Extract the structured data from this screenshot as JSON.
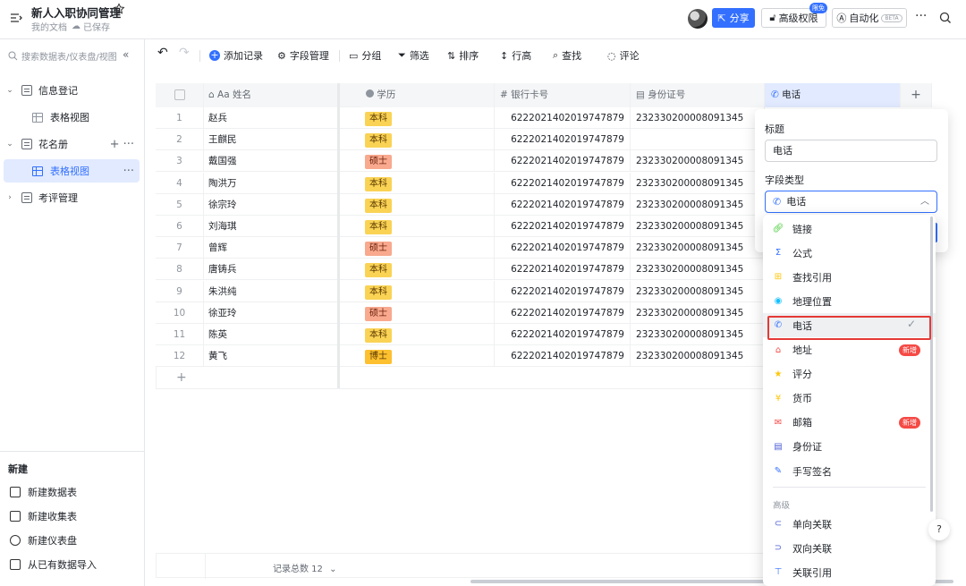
{
  "header": {
    "title": "新人入职协同管理",
    "subtitle": "我的文档",
    "saved": "已保存",
    "share_label": "分享",
    "permission_label": "高级权限",
    "limited_badge": "限免",
    "automation_label": "自动化",
    "beta_label": "BETA"
  },
  "sidebar": {
    "search_placeholder": "搜索数据表/仪表盘/视图",
    "items": [
      {
        "label": "信息登记"
      },
      {
        "label": "表格视图"
      },
      {
        "label": "花名册"
      },
      {
        "label": "表格视图"
      },
      {
        "label": "考评管理"
      }
    ],
    "new_header": "新建",
    "new_items": [
      {
        "label": "新建数据表"
      },
      {
        "label": "新建收集表"
      },
      {
        "label": "新建仪表盘"
      },
      {
        "label": "从已有数据导入"
      }
    ]
  },
  "toolbar": {
    "add_record": "添加记录",
    "field_manage": "字段管理",
    "group": "分组",
    "filter": "筛选",
    "sort": "排序",
    "row_height": "行高",
    "find": "查找",
    "comment": "评论"
  },
  "table": {
    "headers": {
      "name": "姓名",
      "edu": "学历",
      "bank": "银行卡号",
      "id": "身份证号",
      "phone": "电话"
    },
    "rows": [
      {
        "num": "1",
        "name": "赵兵",
        "edu": "本科",
        "bank": "6222021402019747879",
        "id": "232330200008091345"
      },
      {
        "num": "2",
        "name": "王麒民",
        "edu": "本科",
        "bank": "6222021402019747879",
        "id": ""
      },
      {
        "num": "3",
        "name": "戴国强",
        "edu": "硕士",
        "bank": "6222021402019747879",
        "id": "232330200008091345"
      },
      {
        "num": "4",
        "name": "陶洪万",
        "edu": "本科",
        "bank": "6222021402019747879",
        "id": "232330200008091345"
      },
      {
        "num": "5",
        "name": "徐宗玲",
        "edu": "本科",
        "bank": "6222021402019747879",
        "id": "232330200008091345"
      },
      {
        "num": "6",
        "name": "刘海琪",
        "edu": "本科",
        "bank": "6222021402019747879",
        "id": "232330200008091345"
      },
      {
        "num": "7",
        "name": "曾辉",
        "edu": "硕士",
        "bank": "6222021402019747879",
        "id": "232330200008091345"
      },
      {
        "num": "8",
        "name": "唐铸兵",
        "edu": "本科",
        "bank": "6222021402019747879",
        "id": "232330200008091345"
      },
      {
        "num": "9",
        "name": "朱洪纯",
        "edu": "本科",
        "bank": "6222021402019747879",
        "id": "232330200008091345"
      },
      {
        "num": "10",
        "name": "徐亚玲",
        "edu": "硕士",
        "bank": "6222021402019747879",
        "id": "232330200008091345"
      },
      {
        "num": "11",
        "name": "陈英",
        "edu": "本科",
        "bank": "6222021402019747879",
        "id": "232330200008091345"
      },
      {
        "num": "12",
        "name": "黄飞",
        "edu": "博士",
        "bank": "6222021402019747879",
        "id": "232330200008091345"
      }
    ],
    "footer_count": "记录总数 12"
  },
  "field_panel": {
    "title_label": "标题",
    "title_value": "电话",
    "type_label": "字段类型",
    "type_value": "电话"
  },
  "dropdown": {
    "items": [
      {
        "label": "链接",
        "icon": "link-icon",
        "color": "#34c724"
      },
      {
        "label": "公式",
        "icon": "sigma-icon",
        "color": "#3370ff"
      },
      {
        "label": "查找引用",
        "icon": "lookup-icon",
        "color": "#ffc60a"
      },
      {
        "label": "地理位置",
        "icon": "location-icon",
        "color": "#14c0ff"
      },
      {
        "label": "电话",
        "icon": "phone-icon",
        "color": "#3370ff",
        "selected": true
      },
      {
        "label": "地址",
        "icon": "address-icon",
        "color": "#f54a45",
        "badge": "新增"
      },
      {
        "label": "评分",
        "icon": "star-icon",
        "color": "#ffc60a"
      },
      {
        "label": "货币",
        "icon": "currency-icon",
        "color": "#ffc60a"
      },
      {
        "label": "邮箱",
        "icon": "mail-icon",
        "color": "#f54a45",
        "badge": "新增"
      },
      {
        "label": "身份证",
        "icon": "id-card-icon",
        "color": "#4e5fd6"
      },
      {
        "label": "手写签名",
        "icon": "signature-icon",
        "color": "#3370ff"
      }
    ],
    "section_label": "高级",
    "advanced_items": [
      {
        "label": "单向关联",
        "icon": "link-one-icon",
        "color": "#4e5fd6"
      },
      {
        "label": "双向关联",
        "icon": "link-two-icon",
        "color": "#4e5fd6"
      },
      {
        "label": "关联引用",
        "icon": "ref-icon",
        "color": "#3370ff"
      }
    ]
  },
  "colors": {
    "accent": "#3370ff",
    "highlight": "#e53935"
  }
}
